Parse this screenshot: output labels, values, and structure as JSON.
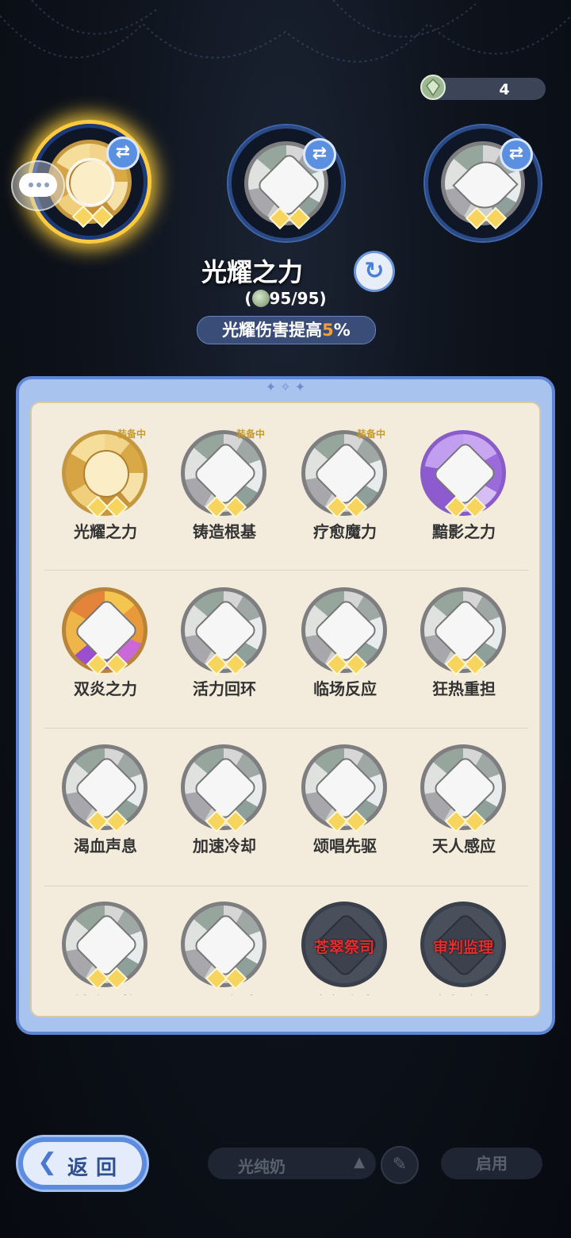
{
  "currency": {
    "icon": "gem-icon",
    "value": "4"
  },
  "equipped": [
    {
      "name": "光耀之力",
      "icon": "radiant-compass-icon",
      "variant": "gold",
      "active": true
    },
    {
      "name": "铸造根基",
      "icon": "crystal-icon",
      "variant": "silver",
      "active": false
    },
    {
      "name": "疗愈魔力",
      "icon": "leaf-icon",
      "variant": "silver",
      "active": false
    }
  ],
  "selected": {
    "title": "光耀之力",
    "cost_open": "(",
    "cost_value": "95/95",
    "cost_close": ")",
    "effect_prefix": "光耀伤害提高",
    "effect_value": "5",
    "effect_suffix": "%"
  },
  "equipped_badge": "装备中",
  "grid": [
    {
      "name": "光耀之力",
      "icon": "radiant-compass-icon",
      "variant": "gold",
      "equipped": true
    },
    {
      "name": "铸造根基",
      "icon": "crystal-icon",
      "variant": "silver",
      "equipped": true
    },
    {
      "name": "疗愈魔力",
      "icon": "leaf-icon",
      "variant": "silver",
      "equipped": true
    },
    {
      "name": "黯影之力",
      "icon": "moon-star-icon",
      "variant": "purple",
      "equipped": false
    },
    {
      "name": "双炎之力",
      "icon": "flame-icon",
      "variant": "fire",
      "equipped": false
    },
    {
      "name": "活力回环",
      "icon": "star-burst-icon",
      "variant": "silver",
      "equipped": false
    },
    {
      "name": "临场反应",
      "icon": "triangle-gem-icon",
      "variant": "silver",
      "equipped": false
    },
    {
      "name": "狂热重担",
      "icon": "eye-icon",
      "variant": "silver",
      "equipped": false
    },
    {
      "name": "渴血声息",
      "icon": "blood-drop-icon",
      "variant": "silver",
      "equipped": false
    },
    {
      "name": "加速冷却",
      "icon": "gauntlet-icon",
      "variant": "silver",
      "equipped": false
    },
    {
      "name": "颂唱先驱",
      "icon": "sun-eye-icon",
      "variant": "silver",
      "equipped": false
    },
    {
      "name": "天人感应",
      "icon": "cross-flower-icon",
      "variant": "silver",
      "equipped": false
    },
    {
      "name": "触底升格",
      "icon": "flower-icon",
      "variant": "silver",
      "equipped": false
    },
    {
      "name": "不退之壁",
      "icon": "shield-icon",
      "variant": "silver",
      "equipped": false
    },
    {
      "name": "自然之力",
      "icon": "locked-nature-icon",
      "variant": "locked",
      "equipped": false,
      "lock_text": "苍翠祭司"
    },
    {
      "name": "审判之力",
      "icon": "locked-judgement-icon",
      "variant": "locked",
      "equipped": false,
      "lock_text": "审判监理"
    }
  ],
  "bottom": {
    "back_label": "返回",
    "preset_name": "光纯奶",
    "enable_label": "启用"
  },
  "colors": {
    "accent": "#5d8be0",
    "gold": "#f2c24a",
    "highlight": "#f2a13a",
    "locked_text": "#e23030"
  }
}
